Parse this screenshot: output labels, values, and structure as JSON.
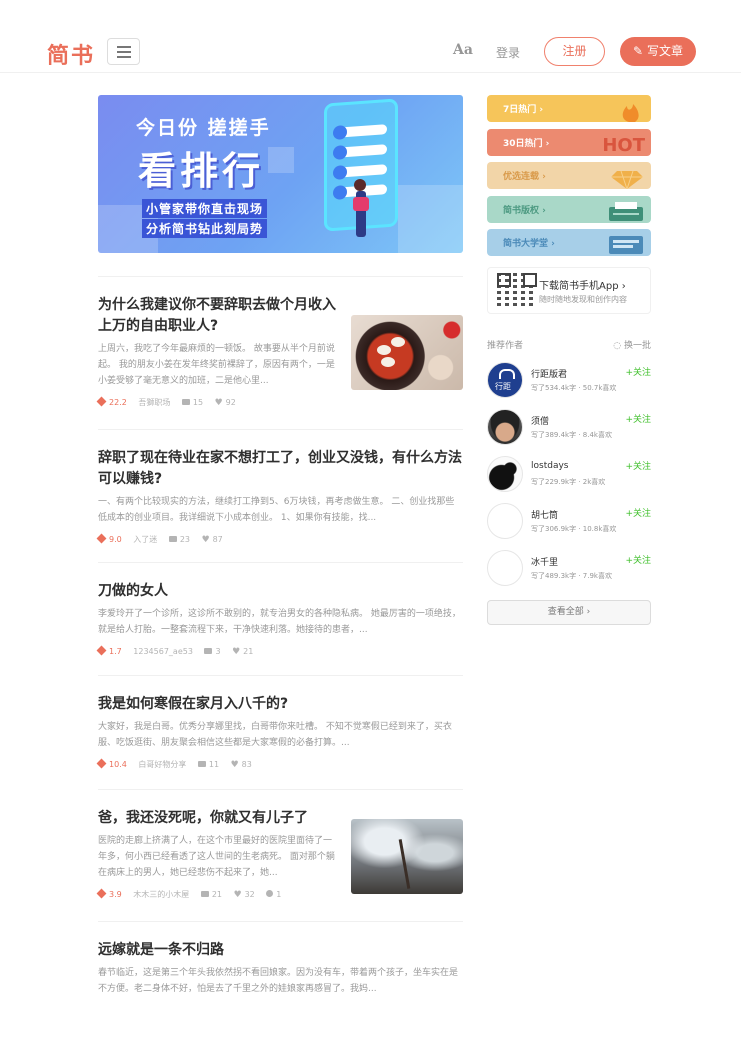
{
  "header": {
    "logo": "简书",
    "aa": "Aa",
    "login": "登录",
    "signup": "注册",
    "write": "写文章"
  },
  "banner": {
    "line1": "今日份 搓搓手",
    "line2": "看排行",
    "line3": "小管家带你直击现场",
    "line4": "分析简书钻此刻局势"
  },
  "articles": [
    {
      "title": "为什么我建议你不要辞职去做个月收入上万的自由职业人?",
      "abstract": "上周六，我吃了今年最麻烦的一顿饭。 故事要从半个月前说起。 我的朋友小姜在发年终奖前裸辞了，原因有两个，一是小姜受够了毫无意义的加班，二是他心里...",
      "jsd": "22.2",
      "author": "吾獅职场",
      "comments": "15",
      "likes": "92",
      "rewards": ""
    },
    {
      "title": "辞职了现在待业在家不想打工了，创业又没钱，有什么方法可以赚钱?",
      "abstract": "一、有两个比较现实的方法，继续打工挣到5、6万块钱，再考虑做生意。 二、创业找那些低成本的创业项目。我详细说下小成本创业。 1、如果你有技能，找...",
      "jsd": "9.0",
      "author": "入了迷",
      "comments": "23",
      "likes": "87",
      "rewards": ""
    },
    {
      "title": "刀做的女人",
      "abstract": "李爱玲开了一个诊所，这诊所不敢别的，就专治男女的各种隐私病。 她最厉害的一项绝技，就是给人打胎。一整套流程下来，干净快速利落。她接待的患者，...",
      "jsd": "1.7",
      "author": "1234567_ae53",
      "comments": "3",
      "likes": "21",
      "rewards": ""
    },
    {
      "title": "我是如何寒假在家月入八千的?",
      "abstract": "大家好，我是白哥。优秀分享娜里找，白哥带你来吐槽。 不知不觉寒假已经到来了，买衣服、吃饭逛街、朋友聚会相信这些都是大家寒假的必备打算。...",
      "jsd": "10.4",
      "author": "白哥好物分享",
      "comments": "11",
      "likes": "83",
      "rewards": ""
    },
    {
      "title": "爸，我还没死呢，你就又有儿子了",
      "abstract": "医院的走廊上挤满了人，在这个市里最好的医院里面待了一年多，何小西已经看透了这人世间的生老病死。 面对那个躺在病床上的男人，她已经悲伤不起来了，她...",
      "jsd": "3.9",
      "author": "木木三的小木屋",
      "comments": "21",
      "likes": "32",
      "rewards": "1"
    },
    {
      "title": "远嫁就是一条不归路",
      "abstract": "春节临近，这是第三个年头我依然拐不看回娘家。因为没有车，带着两个孩子，坐车实在是不方便。老二身体不好，怕是去了千里之外的娃娘家再感冒了。我妈...",
      "jsd": "",
      "author": "",
      "comments": "",
      "likes": "",
      "rewards": ""
    }
  ],
  "sidebar": {
    "boards": [
      "7日热门 ›",
      "30日热门 ›",
      "优选连载 ›",
      "简书版权 ›",
      "简书大学堂 ›"
    ],
    "hot_deco": "HOT",
    "app": {
      "title": "下载简书手机App ›",
      "subtitle": "随时随地发现和创作内容"
    },
    "rec_title": "推荐作者",
    "refresh": "◌ 换一批",
    "follow_label": "+关注",
    "authors": [
      {
        "name": "行距版君",
        "desc": "写了534.4k字 · 50.7k喜欢"
      },
      {
        "name": "须僧",
        "desc": "写了389.4k字 · 8.4k喜欢"
      },
      {
        "name": "lostdays",
        "desc": "写了229.9k字 · 2k喜欢"
      },
      {
        "name": "胡七筒",
        "desc": "写了306.9k字 · 10.8k喜欢"
      },
      {
        "name": "冰千里",
        "desc": "写了489.3k字 · 7.9k喜欢"
      }
    ],
    "view_all": "查看全部 ›"
  },
  "colors": {
    "brand": "#ea6f5a",
    "follow": "#42c02e"
  }
}
